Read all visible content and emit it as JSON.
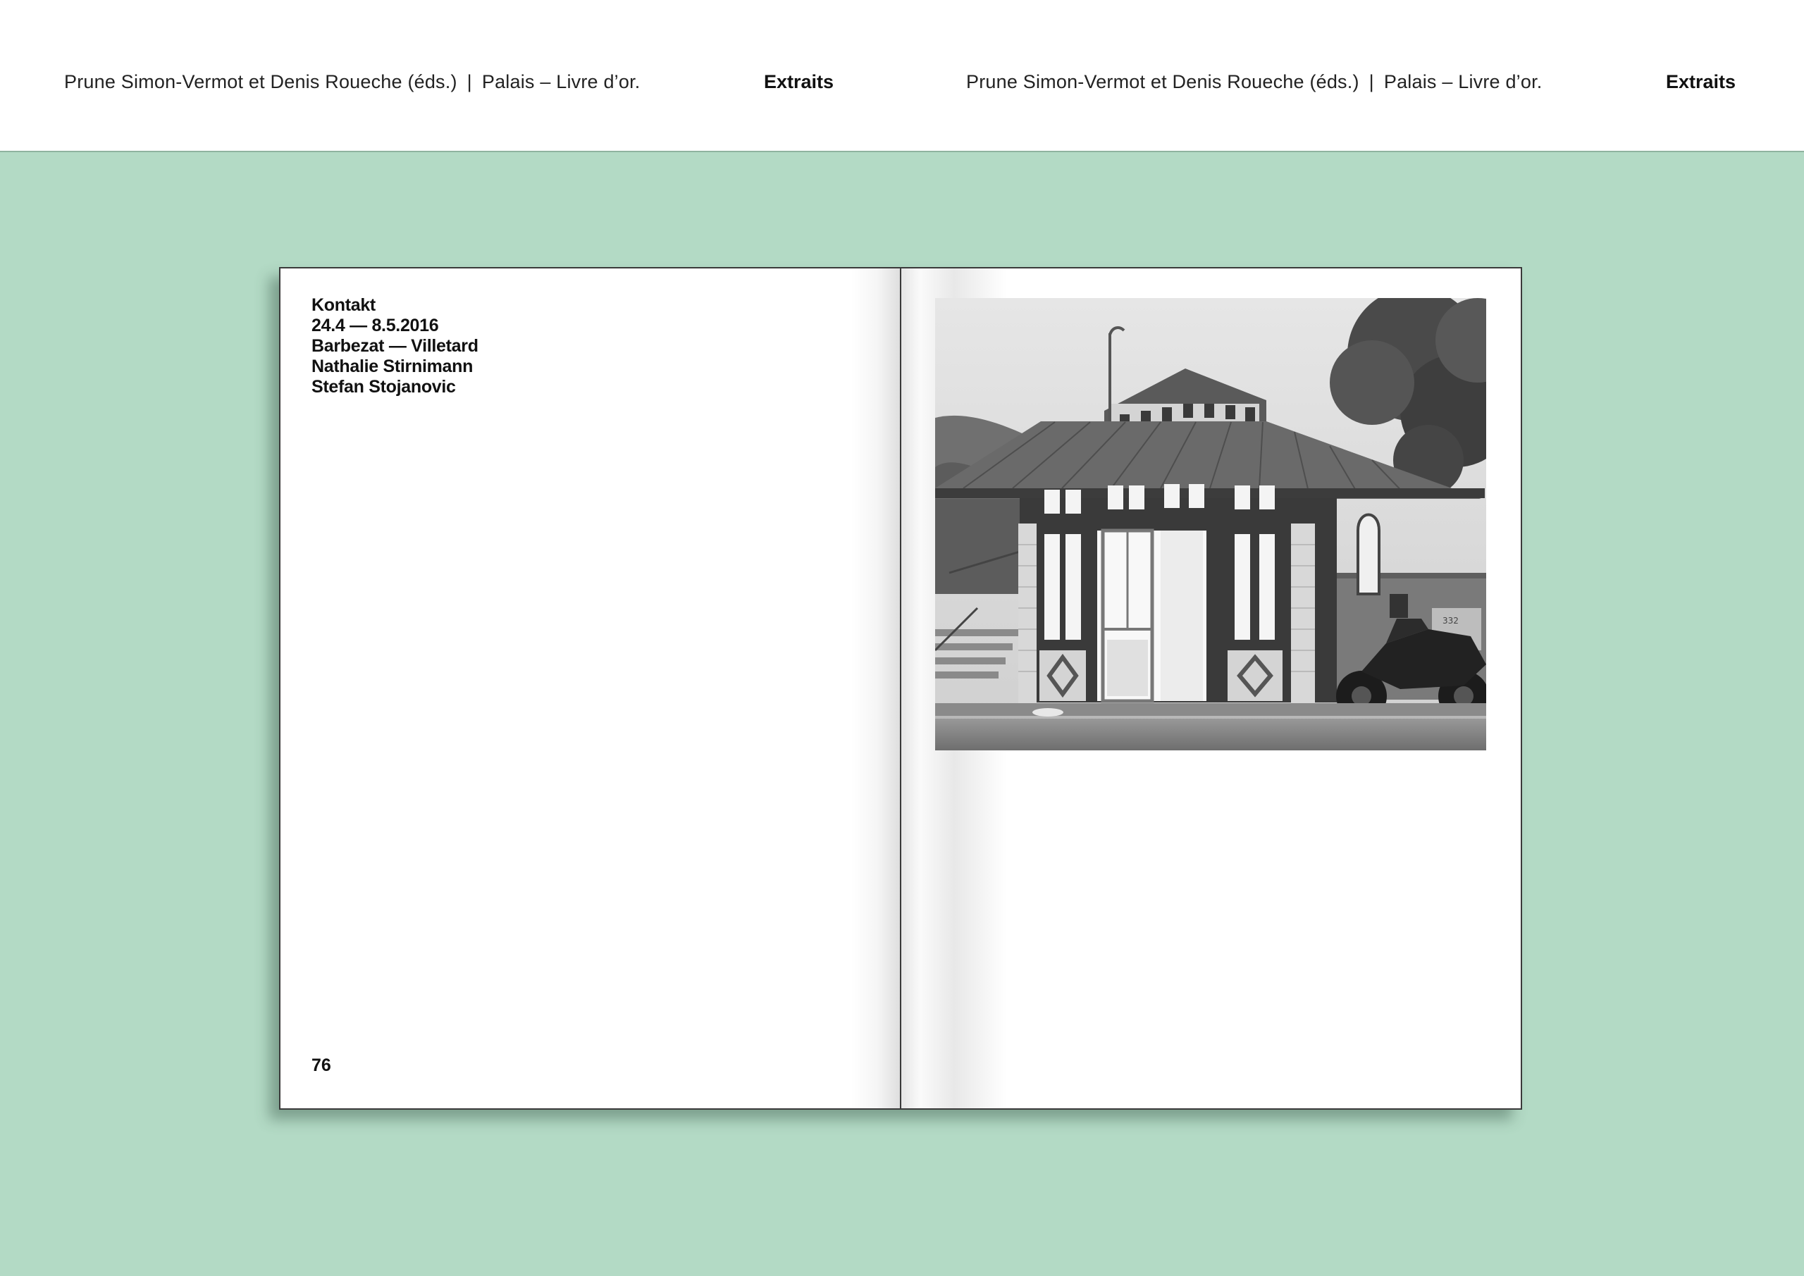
{
  "header": {
    "left": {
      "authors": "Prune Simon-Vermot et Denis Roueche (éds.)",
      "separator": "|",
      "title": "Palais – Livre d’or.",
      "section": "Extraits"
    },
    "right": {
      "authors": "Prune Simon-Vermot et Denis Roueche (éds.)",
      "separator": "|",
      "title": "Palais – Livre d’or.",
      "section": "Extraits"
    }
  },
  "left_page": {
    "credits": [
      "Kontakt",
      "24.4 — 8.5.2016",
      "Barbezat — Villetard",
      "Nathalie Stirnimann",
      "Stefan Stojanovic"
    ],
    "page_number": "76"
  },
  "right_page": {
    "photo": {
      "tone": "black-and-white",
      "box_number": "332"
    }
  }
}
